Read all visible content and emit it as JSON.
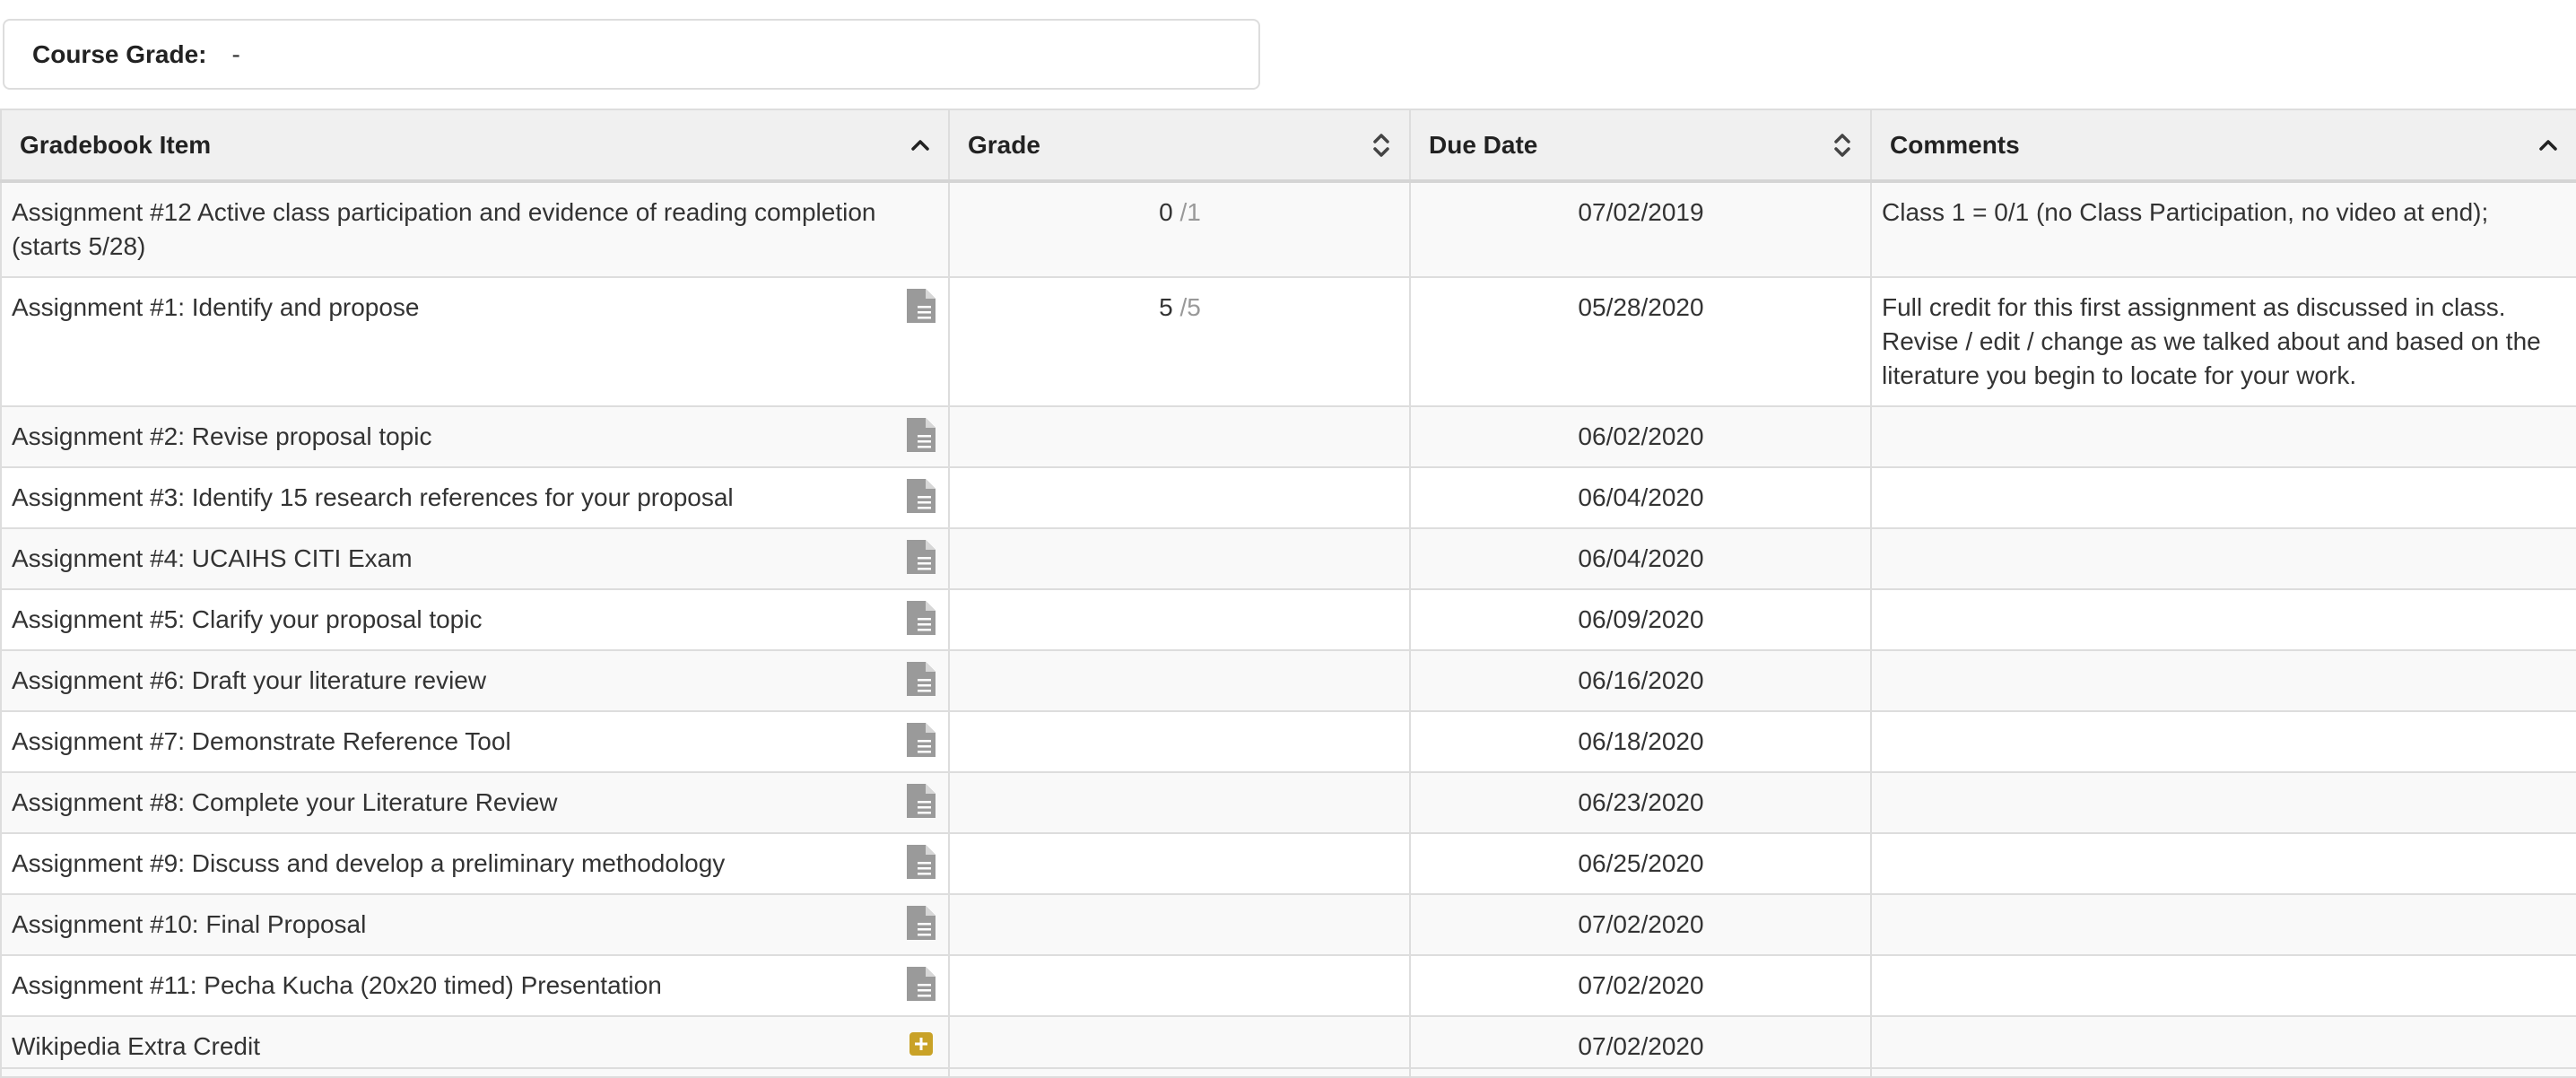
{
  "course_grade": {
    "label": "Course Grade:",
    "value": "-"
  },
  "table": {
    "headers": {
      "item": "Gradebook Item",
      "grade": "Grade",
      "due": "Due Date",
      "comments": "Comments"
    },
    "sort_icons": {
      "item": "sort-asc-icon",
      "grade": "sort-both-icon",
      "due": "sort-both-icon",
      "comments": "sort-asc-icon"
    },
    "rows": [
      {
        "item": "Assignment #12 Active class participation and evidence of reading completion (starts 5/28)",
        "icon": "",
        "grade_points": "0",
        "grade_out": "/1",
        "due": "07/02/2019",
        "comments": "Class 1 = 0/1 (no Class Participation, no video at end);"
      },
      {
        "item": "Assignment #1: Identify and propose",
        "icon": "document-icon",
        "grade_points": "5",
        "grade_out": "/5",
        "due": "05/28/2020",
        "comments": "Full credit for this first assignment as discussed in class. Revise / edit / change as we talked about and based on the literature you begin to locate for your work."
      },
      {
        "item": "Assignment #2: Revise proposal topic",
        "icon": "document-icon",
        "grade_points": "",
        "grade_out": "",
        "due": "06/02/2020",
        "comments": ""
      },
      {
        "item": "Assignment #3: Identify 15 research references for your proposal",
        "icon": "document-icon",
        "grade_points": "",
        "grade_out": "",
        "due": "06/04/2020",
        "comments": ""
      },
      {
        "item": "Assignment #4: UCAIHS CITI Exam",
        "icon": "document-icon",
        "grade_points": "",
        "grade_out": "",
        "due": "06/04/2020",
        "comments": ""
      },
      {
        "item": "Assignment #5: Clarify your proposal topic",
        "icon": "document-icon",
        "grade_points": "",
        "grade_out": "",
        "due": "06/09/2020",
        "comments": ""
      },
      {
        "item": "Assignment #6: Draft your literature review",
        "icon": "document-icon",
        "grade_points": "",
        "grade_out": "",
        "due": "06/16/2020",
        "comments": ""
      },
      {
        "item": "Assignment #7: Demonstrate Reference Tool",
        "icon": "document-icon",
        "grade_points": "",
        "grade_out": "",
        "due": "06/18/2020",
        "comments": ""
      },
      {
        "item": "Assignment #8: Complete your Literature Review",
        "icon": "document-icon",
        "grade_points": "",
        "grade_out": "",
        "due": "06/23/2020",
        "comments": ""
      },
      {
        "item": "Assignment #9: Discuss and develop a preliminary methodology",
        "icon": "document-icon",
        "grade_points": "",
        "grade_out": "",
        "due": "06/25/2020",
        "comments": ""
      },
      {
        "item": "Assignment #10: Final Proposal",
        "icon": "document-icon",
        "grade_points": "",
        "grade_out": "",
        "due": "07/02/2020",
        "comments": ""
      },
      {
        "item": "Assignment #11: Pecha Kucha (20x20 timed) Presentation",
        "icon": "document-icon",
        "grade_points": "",
        "grade_out": "",
        "due": "07/02/2020",
        "comments": ""
      },
      {
        "item": "Wikipedia Extra Credit",
        "icon": "extra-credit-icon",
        "grade_points": "",
        "grade_out": "",
        "due": "07/02/2020",
        "comments": ""
      }
    ]
  },
  "colors": {
    "header_bg": "#f0f0f0",
    "border": "#dddddd",
    "icon_gray": "#9a9a9a",
    "extra_credit": "#c9a227",
    "muted_text": "#999999"
  }
}
